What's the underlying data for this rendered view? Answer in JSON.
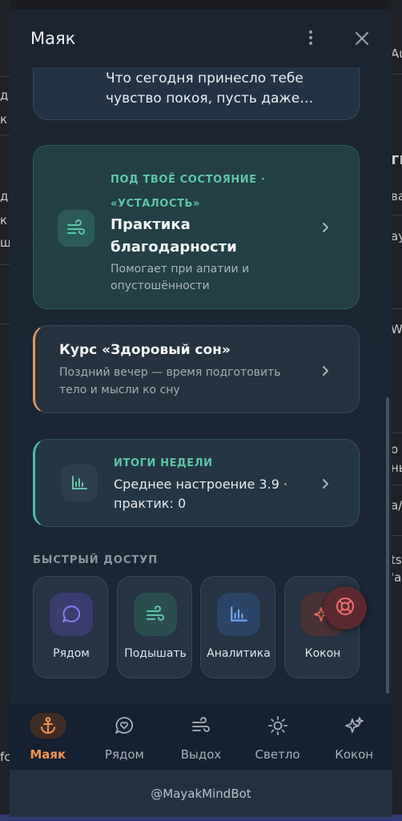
{
  "background_page": {
    "left_fragments": [
      "д",
      "к",
      "д",
      "к",
      "ш",
      "fc"
    ],
    "right_fragments": [
      "Au",
      "гг",
      "ва",
      "ау",
      "W",
      "о",
      "ны",
      "а/",
      "ts",
      "'a"
    ]
  },
  "header": {
    "title": "Маяк",
    "menu_icon": "kebab-icon",
    "close_icon": "close-icon"
  },
  "prompt_card": {
    "text": "Что сегодня принесло тебе чувство покоя, пусть даже…"
  },
  "practice_card": {
    "tag": "ПОД ТВОЁ СОСТОЯНИЕ · «УСТАЛОСТЬ»",
    "title": "Практика благодарности",
    "subtitle": "Помогает при апатии и опустошённости",
    "icon": "wind-icon",
    "accent": "#5ec6a8"
  },
  "course_card": {
    "title": "Курс «Здоровый сон»",
    "subtitle": "Поздний вечер — время подготовить тело и мысли ко сну",
    "accent": "#e3955c"
  },
  "week_card": {
    "tag": "ИТОГИ НЕДЕЛИ",
    "text": "Среднее настроение 3.9 · практик: 0",
    "icon": "bar-chart-icon",
    "accent": "#4bbfa3"
  },
  "quick_access": {
    "label": "БЫСТРЫЙ ДОСТУП",
    "tiles": [
      {
        "label": "Рядом",
        "icon": "chat-bubble-icon",
        "color": "#8f7bf0"
      },
      {
        "label": "Подышать",
        "icon": "wind-icon",
        "color": "#5ec6a8"
      },
      {
        "label": "Аналитика",
        "icon": "bar-chart-icon",
        "color": "#6fa8f2"
      },
      {
        "label": "Кокон",
        "icon": "sparkles-icon",
        "color": "#e8705f"
      }
    ]
  },
  "sos_button": {
    "icon": "lifebuoy-icon",
    "color": "#ef6d6d"
  },
  "nav": {
    "items": [
      {
        "label": "Маяк",
        "icon": "anchor-icon",
        "active": true
      },
      {
        "label": "Рядом",
        "icon": "heart-bubble-icon",
        "active": false
      },
      {
        "label": "Выдох",
        "icon": "wind-icon",
        "active": false
      },
      {
        "label": "Светло",
        "icon": "sun-icon",
        "active": false
      },
      {
        "label": "Кокон",
        "icon": "sparkles-icon",
        "active": false
      }
    ],
    "active_color": "#f29450"
  },
  "footer": {
    "text": "@MayakMindBot"
  }
}
